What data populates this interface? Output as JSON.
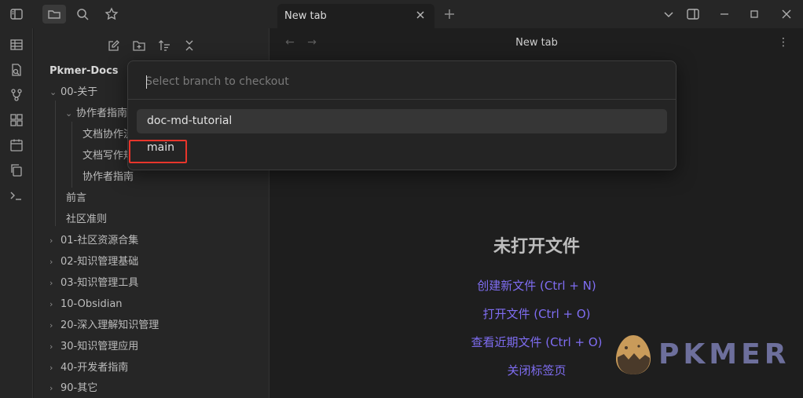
{
  "titlebar": {
    "tab_label": "New tab",
    "icons": [
      "sidebar-toggle-icon",
      "folder-icon",
      "search-icon",
      "star-icon",
      "close-icon",
      "plus-icon",
      "chevron-down-icon",
      "sidebar-right-icon",
      "minimize-icon",
      "maximize-icon",
      "close-window-icon"
    ]
  },
  "ribbon": {
    "icons": [
      "table-icon",
      "file-search-icon",
      "git-branch-icon",
      "layout-grid-icon",
      "calendar-icon",
      "copy-icon",
      "terminal-icon"
    ]
  },
  "sidebar": {
    "tools": [
      "new-note-icon",
      "new-folder-icon",
      "sort-icon",
      "collapse-icon"
    ],
    "vault_title": "Pkmer-Docs",
    "tree": [
      {
        "label": "00-关于",
        "chevron": "⌄"
      },
      {
        "label": "协作者指南",
        "chevron": "⌄"
      },
      {
        "label": "文档协作流程"
      },
      {
        "label": "文档写作规范"
      },
      {
        "label": "协作者指南"
      },
      {
        "label": "前言"
      },
      {
        "label": "社区准则"
      },
      {
        "label": "01-社区资源合集",
        "chevron": "›"
      },
      {
        "label": "02-知识管理基础",
        "chevron": "›"
      },
      {
        "label": "03-知识管理工具",
        "chevron": "›"
      },
      {
        "label": "10-Obsidian",
        "chevron": "›"
      },
      {
        "label": "20-深入理解知识管理",
        "chevron": "›"
      },
      {
        "label": "30-知识管理应用",
        "chevron": "›"
      },
      {
        "label": "40-开发者指南",
        "chevron": "›"
      },
      {
        "label": "90-其它",
        "chevron": "›"
      }
    ]
  },
  "main": {
    "header_title": "New tab",
    "empty_title": "未打开文件",
    "links": [
      "创建新文件 (Ctrl + N)",
      "打开文件 (Ctrl + O)",
      "查看近期文件 (Ctrl + O)",
      "关闭标签页"
    ]
  },
  "modal": {
    "placeholder": "Select branch to checkout",
    "value": "",
    "suggestions": [
      "doc-md-tutorial",
      "main"
    ],
    "selected_index": 0
  },
  "watermark": {
    "brand_text": "PKMER"
  },
  "colors": {
    "accent": "#7f6df2",
    "highlight": "#e8352b",
    "background": "#1e1e1e",
    "panel": "#262626"
  }
}
